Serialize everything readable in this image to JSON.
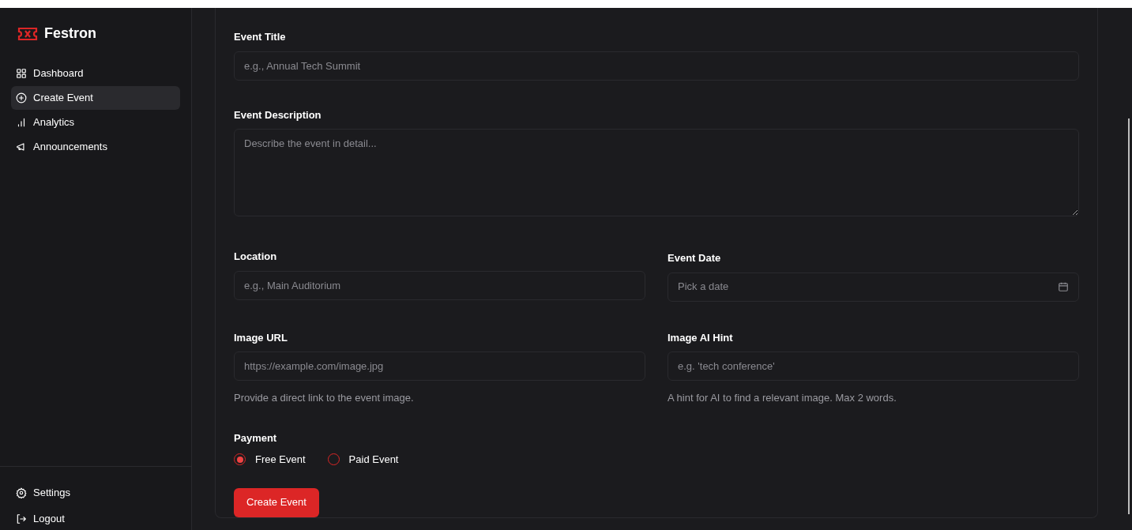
{
  "brand": {
    "name": "Festron"
  },
  "nav": [
    {
      "label": "Dashboard",
      "kind": "grid",
      "selected": false
    },
    {
      "label": "Create Event",
      "kind": "plus",
      "selected": true
    },
    {
      "label": "Analytics",
      "kind": "bars",
      "selected": false
    },
    {
      "label": "Announcements",
      "kind": "megaphone",
      "selected": false
    }
  ],
  "nav_bottom": [
    {
      "label": "Settings",
      "kind": "gear"
    },
    {
      "label": "Logout",
      "kind": "logout"
    }
  ],
  "form": {
    "title_field": {
      "label": "Event Title",
      "placeholder": "e.g., Annual Tech Summit"
    },
    "description_field": {
      "label": "Event Description",
      "placeholder": "Describe the event in detail..."
    },
    "location_field": {
      "label": "Location",
      "placeholder": "e.g., Main Auditorium"
    },
    "date_field": {
      "label": "Event Date",
      "placeholder": "Pick a date"
    },
    "image_url_field": {
      "label": "Image URL",
      "placeholder": "https://example.com/image.jpg",
      "help": "Provide a direct link to the event image."
    },
    "image_hint_field": {
      "label": "Image AI Hint",
      "placeholder": "e.g. 'tech conference'",
      "help": "A hint for AI to find a relevant image. Max 2 words."
    },
    "payment": {
      "label": "Payment",
      "options": [
        {
          "label": "Free Event",
          "selected": true
        },
        {
          "label": "Paid Event",
          "selected": false
        }
      ]
    },
    "submit": "Create Event"
  }
}
